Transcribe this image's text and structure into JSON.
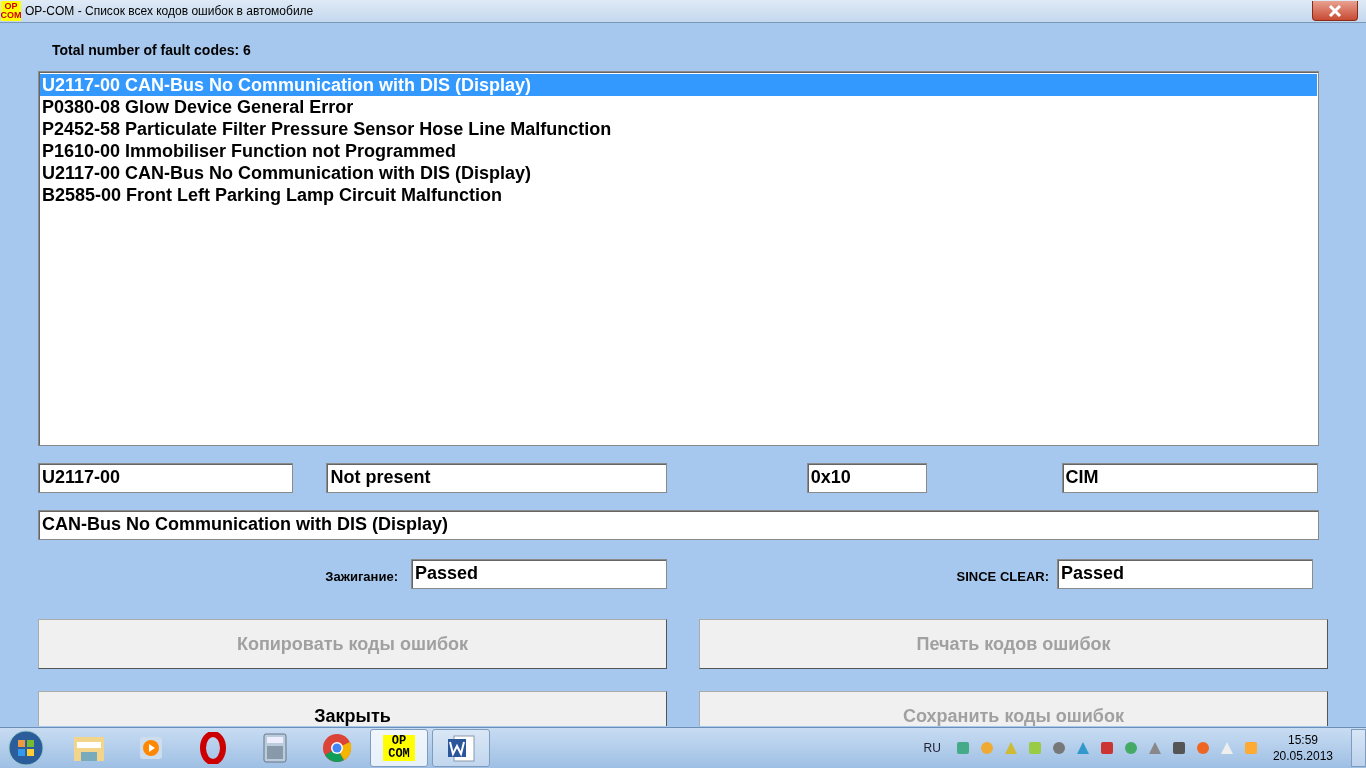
{
  "window": {
    "title": "OP-COM - Список всех кодов ошибок в автомобиле",
    "icon_lines": [
      "OP",
      "COM"
    ]
  },
  "total_label": "Total number of fault codes: 6",
  "fault_codes": [
    {
      "text": "U2117-00 CAN-Bus No Communication with DIS (Display)",
      "selected": true
    },
    {
      "text": "P0380-08 Glow Device General Error",
      "selected": false
    },
    {
      "text": "P2452-58 Particulate Filter Pressure Sensor Hose Line Malfunction",
      "selected": false
    },
    {
      "text": "P1610-00 Immobiliser Function not Programmed",
      "selected": false
    },
    {
      "text": "U2117-00 CAN-Bus No Communication with DIS (Display)",
      "selected": false
    },
    {
      "text": "B2585-00 Front Left Parking Lamp Circuit Malfunction",
      "selected": false
    }
  ],
  "detail": {
    "code": "U2117-00",
    "status": "Not present",
    "hex": "0x10",
    "module": "CIM",
    "description": "CAN-Bus No Communication with DIS (Display)"
  },
  "tests": [
    {
      "label": "Зажигание:",
      "value": "Passed"
    },
    {
      "label": "SINCE CLEAR:",
      "value": "Passed"
    }
  ],
  "buttons": [
    {
      "label": "Копировать коды ошибок",
      "disabled": true
    },
    {
      "label": "Печать кодов ошибок",
      "disabled": true
    },
    {
      "label": "Закрыть",
      "disabled": false
    },
    {
      "label": "Сохранить коды ошибок",
      "disabled": true
    }
  ],
  "taskbar": {
    "apps": [
      {
        "kind": "folder"
      },
      {
        "kind": "media"
      },
      {
        "kind": "opera"
      },
      {
        "kind": "calculator"
      },
      {
        "kind": "chrome"
      },
      {
        "kind": "opcom",
        "lines": [
          "OP",
          "COM"
        ],
        "selected": true
      },
      {
        "kind": "word",
        "selected": false
      }
    ],
    "language": "RU",
    "time": "15:59",
    "date": "20.05.2013"
  }
}
